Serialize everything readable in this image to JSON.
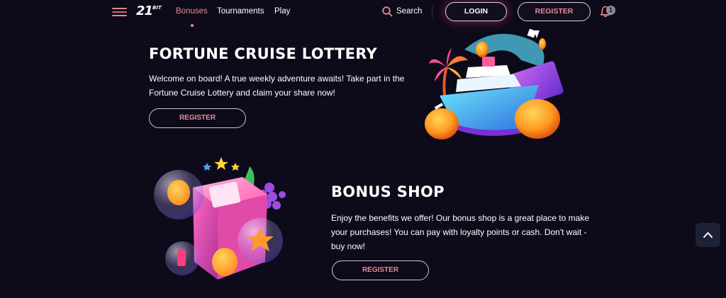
{
  "header": {
    "logo_big": "21",
    "logo_small": "BIT",
    "nav": {
      "bonuses": "Bonuses",
      "tournaments": "Tournaments",
      "play": "Play"
    },
    "search_label": "Search",
    "login_label": "LOGIN",
    "register_label": "REGISTER",
    "notification_count": "1"
  },
  "sections": [
    {
      "title": "FORTUNE CRUISE LOTTERY",
      "description": "Welcome on board! A true weekly adventure awaits! Take part in the Fortune Cruise Lottery and claim your share now!",
      "button_label": "REGISTER",
      "illustration": "cruise-ship-illustration"
    },
    {
      "title": "BONUS SHOP",
      "description": "Enjoy the benefits we offer! Our bonus shop is a great place to make your purchases! You can pay with loyalty points or cash. Don't wait - buy now!",
      "button_label": "REGISTER",
      "illustration": "gift-box-illustration"
    }
  ],
  "colors": {
    "background": "#0d0a1a",
    "accent": "#e98a95",
    "button_border": "#cbc6da",
    "scroll_button": "#1e2136"
  },
  "icons": {
    "menu": "hamburger-icon",
    "search": "search-icon",
    "notifications": "bell-icon",
    "scroll_top": "chevron-up-icon"
  }
}
